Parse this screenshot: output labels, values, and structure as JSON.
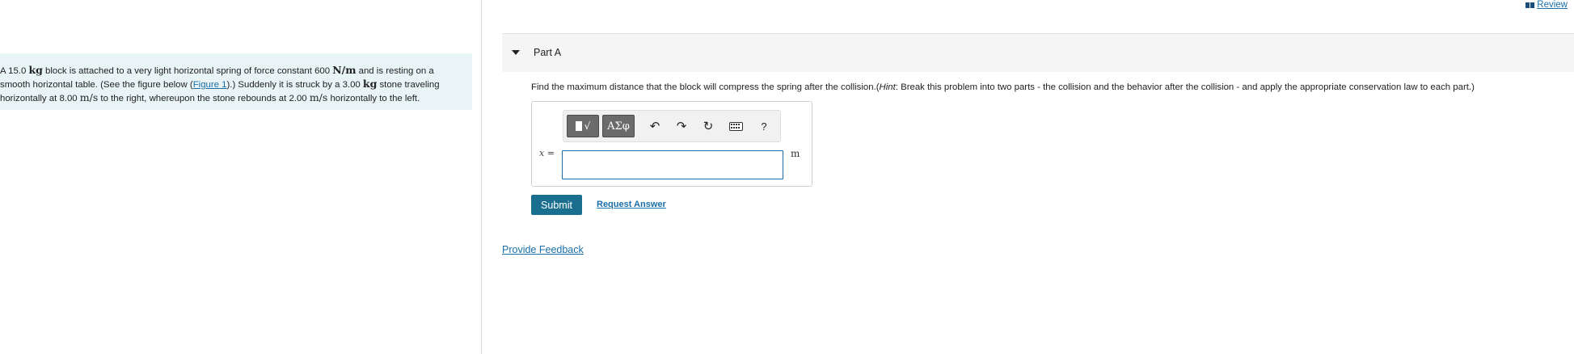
{
  "header": {
    "review_label": "Review"
  },
  "problem": {
    "segments": [
      {
        "t": "A 15.0 ",
        "s": "text"
      },
      {
        "t": "kg",
        "s": "unit"
      },
      {
        "t": " block is attached to a very light horizontal spring of force constant 600 ",
        "s": "text"
      },
      {
        "t": "N/m",
        "s": "unit"
      },
      {
        "t": " and is resting on a smooth horizontal table. (See the figure below (",
        "s": "text"
      },
      {
        "t": "Figure 1",
        "s": "link"
      },
      {
        "t": ").) Suddenly it is struck by a 3.00 ",
        "s": "text"
      },
      {
        "t": "kg",
        "s": "unit"
      },
      {
        "t": " stone traveling horizontally at 8.00 ",
        "s": "text"
      },
      {
        "t": "m/s",
        "s": "math"
      },
      {
        "t": " to the right, whereupon the stone rebounds at 2.00 ",
        "s": "text"
      },
      {
        "t": "m/s",
        "s": "math"
      },
      {
        "t": " horizontally to the left.",
        "s": "text"
      }
    ]
  },
  "part": {
    "title": "Part A",
    "question_main": "Find the maximum distance that the block will compress the spring after the collision.(",
    "hint_label": "Hint",
    "hint_text": ": Break this problem into two parts - the collision and the behavior after the collision - and apply the appropriate conservation law to each part.)"
  },
  "answer": {
    "variable": "x =",
    "value": "",
    "unit": "m",
    "toolbar": {
      "templates_symbol": "√",
      "greek_label": "ΑΣφ",
      "undo_icon": "↶",
      "redo_icon": "↷",
      "reset_icon": "↻",
      "help_label": "?"
    }
  },
  "actions": {
    "submit_label": "Submit",
    "request_answer_label": "Request Answer",
    "feedback_label": "Provide Feedback"
  },
  "colors": {
    "accent": "#1a6f8f",
    "link": "#1a6fa8",
    "problem_bg": "#e8f4f6"
  }
}
